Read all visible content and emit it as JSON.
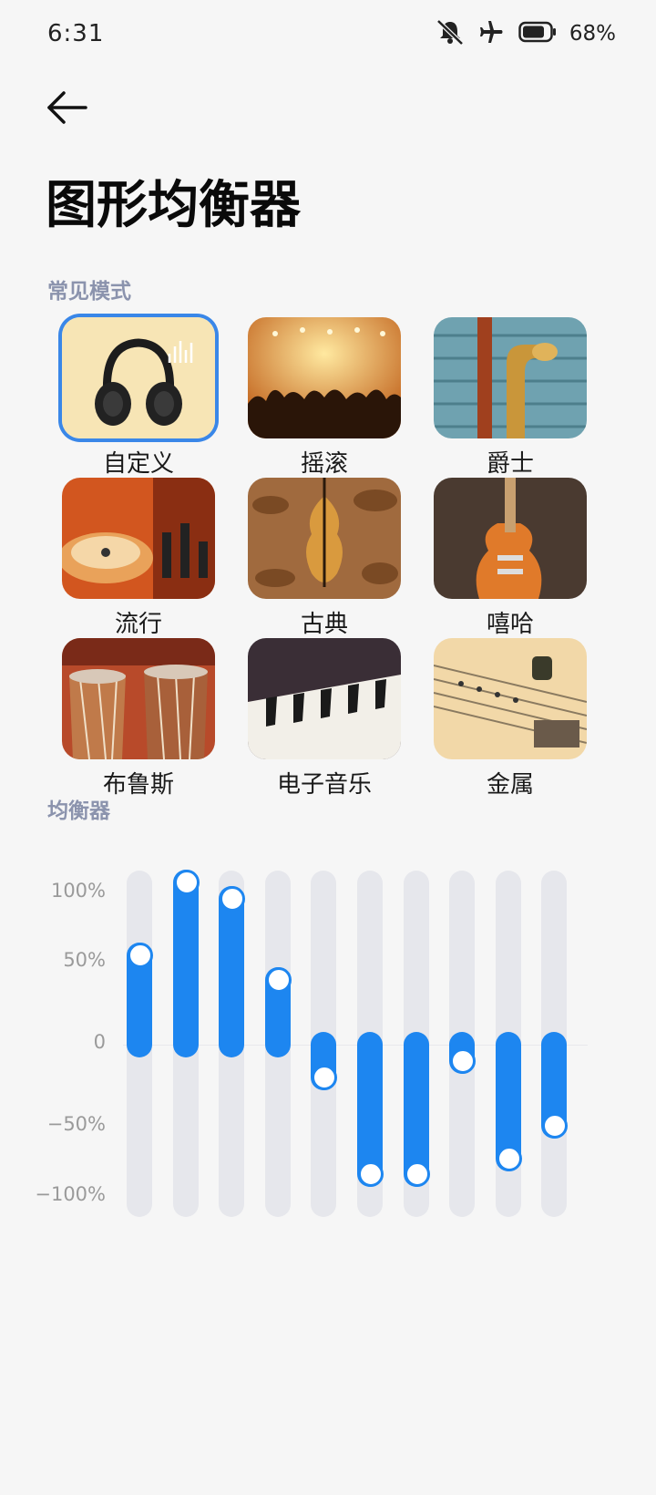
{
  "status": {
    "time": "6:31",
    "battery": "68%",
    "icons": [
      "mute-icon",
      "airplane-icon",
      "battery-icon"
    ]
  },
  "header": {
    "title": "图形均衡器"
  },
  "sections": {
    "modes_title": "常见模式",
    "eq_title": "均衡器"
  },
  "modes": [
    {
      "label": "自定义",
      "selected": true,
      "art": "headphones"
    },
    {
      "label": "摇滚",
      "selected": false,
      "art": "concert-crowd"
    },
    {
      "label": "爵士",
      "selected": false,
      "art": "saxophone"
    },
    {
      "label": "流行",
      "selected": false,
      "art": "dj-turntable"
    },
    {
      "label": "古典",
      "selected": false,
      "art": "violin"
    },
    {
      "label": "嘻哈",
      "selected": false,
      "art": "electric-guitar"
    },
    {
      "label": "布鲁斯",
      "selected": false,
      "art": "tabla-drums"
    },
    {
      "label": "电子音乐",
      "selected": false,
      "art": "keyboard"
    },
    {
      "label": "金属",
      "selected": false,
      "art": "guitar-strings"
    }
  ],
  "equalizer": {
    "axis_labels": [
      "100%",
      "50%",
      "0",
      "−50%",
      "−100%"
    ],
    "bands_percent": [
      55,
      100,
      90,
      40,
      -20,
      -80,
      -80,
      -10,
      -70,
      -50
    ],
    "accent_color": "#1d86f0",
    "track_color": "#e6e7ec"
  }
}
